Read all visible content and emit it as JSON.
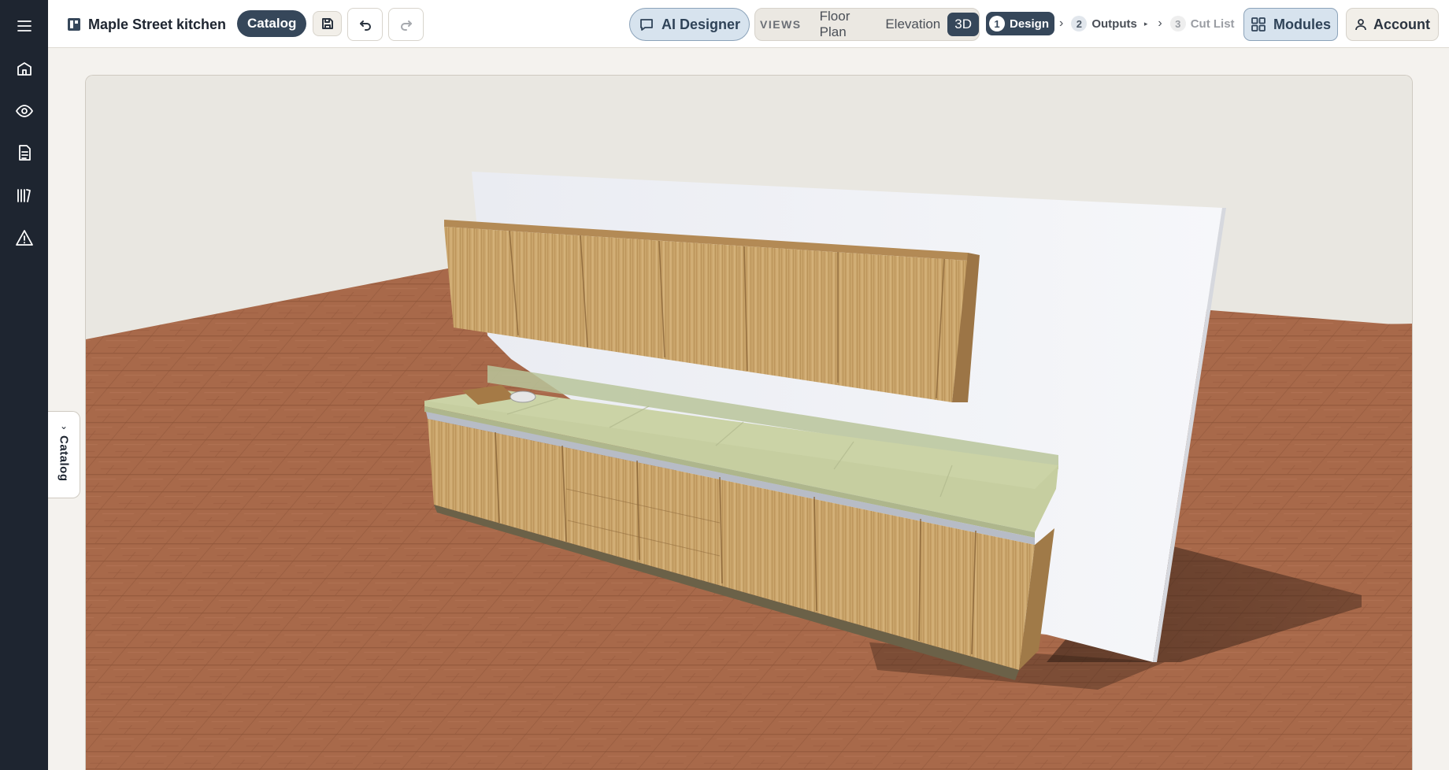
{
  "rail": {
    "items": [
      {
        "name": "menu-icon"
      },
      {
        "name": "home-icon"
      },
      {
        "name": "eye-icon"
      },
      {
        "name": "document-icon"
      },
      {
        "name": "library-icon"
      },
      {
        "name": "warning-icon"
      }
    ]
  },
  "header": {
    "project_name": "Maple Street kitchen",
    "catalog_label": "Catalog",
    "ai_designer_label": "AI Designer",
    "views_label": "VIEWS",
    "views": [
      {
        "label": "Floor Plan",
        "active": false
      },
      {
        "label": "Elevation",
        "active": false
      },
      {
        "label": "3D",
        "active": true
      }
    ],
    "steps": [
      {
        "num": "1",
        "label": "Design",
        "state": "active"
      },
      {
        "num": "2",
        "label": "Outputs",
        "state": "normal"
      },
      {
        "num": "3",
        "label": "Cut List",
        "state": "muted"
      }
    ],
    "modules_label": "Modules",
    "account_label": "Account"
  },
  "catalog_drawer": {
    "label": "Catalog"
  },
  "colors": {
    "rail": "#1e2530",
    "accent_dark": "#36475a",
    "accent_light": "#d7e3ee",
    "floor_wood": "#a8694a",
    "cabinet_wood": "#c9a468",
    "countertop": "#c4cc9e",
    "wall": "#f3f4f8"
  }
}
